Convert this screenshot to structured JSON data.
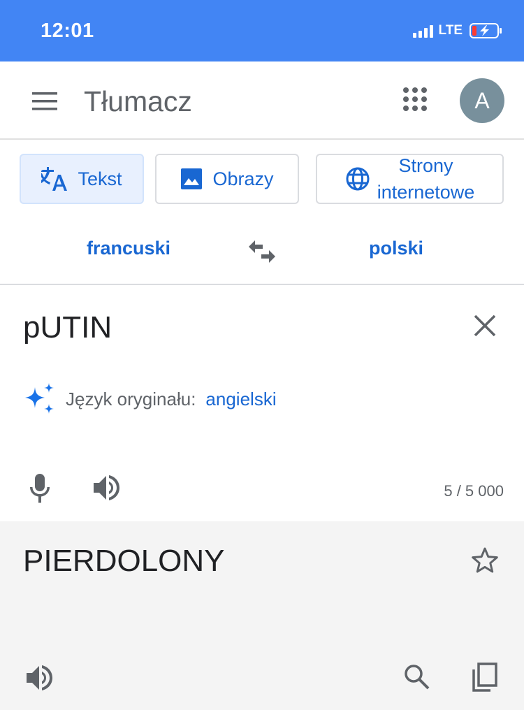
{
  "status_bar": {
    "time": "12:01",
    "network": "LTE",
    "bar_color": "#4285f4"
  },
  "app_bar": {
    "title": "Tłumacz",
    "avatar_initial": "A",
    "avatar_color": "#78909c"
  },
  "modes": [
    {
      "label": "Tekst",
      "icon": "translate-icon",
      "active": true
    },
    {
      "label": "Obrazy",
      "icon": "image-icon",
      "active": false
    },
    {
      "label_line1": "Strony",
      "label_line2": "internetowe",
      "icon": "globe-icon",
      "active": false
    }
  ],
  "languages": {
    "source": "francuski",
    "target": "polski"
  },
  "source_panel": {
    "text": "pUTIN",
    "detected_label": "Język oryginału:",
    "detected_value": "angielski",
    "char_count": "5 / 5 000"
  },
  "target_panel": {
    "text": "PIERDOLONY",
    "background": "#f4f4f4"
  },
  "colors": {
    "accent": "#1967d2",
    "active_tab_bg": "#e8f0fe",
    "text": "#202124",
    "muted": "#5f6368"
  }
}
